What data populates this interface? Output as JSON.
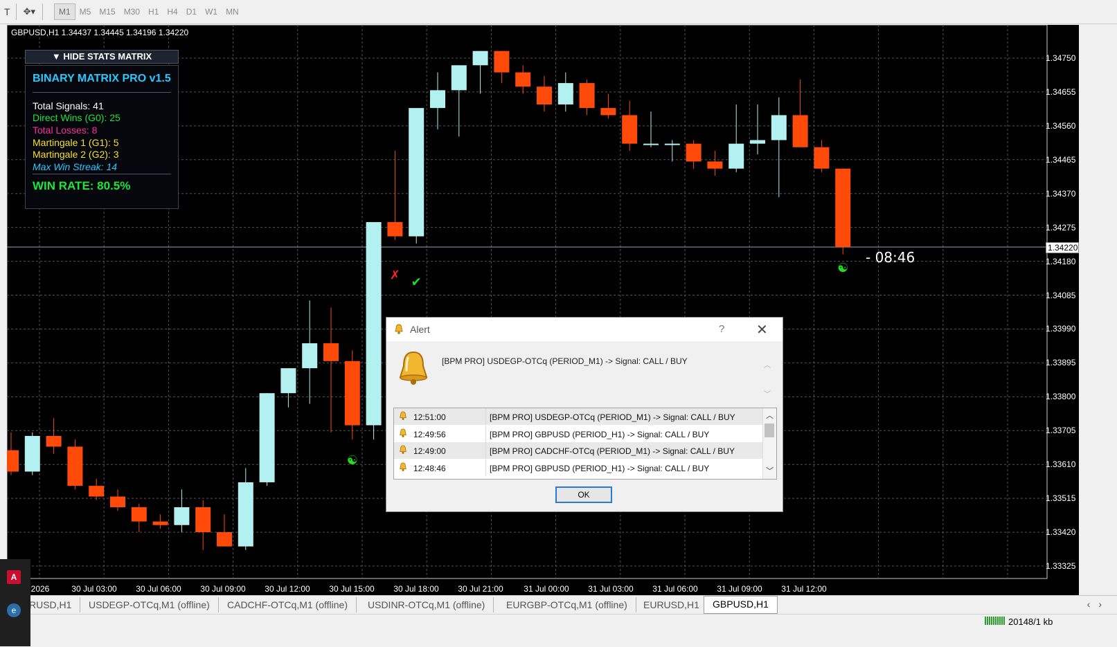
{
  "toolbar": {
    "timeframes": [
      "M1",
      "M5",
      "M15",
      "M30",
      "H1",
      "H4",
      "D1",
      "W1",
      "MN"
    ],
    "active_timeframe": "M1"
  },
  "chart": {
    "symbol_info": "GBPUSD,H1  1.34437 1.34445 1.34196 1.34220",
    "current_price": "1.34220",
    "countdown": "- 08:46",
    "price_axis": [
      "1.34750",
      "1.34655",
      "1.34560",
      "1.34465",
      "1.34370",
      "1.34275",
      "1.34180",
      "1.34085",
      "1.33990",
      "1.33895",
      "1.33800",
      "1.33705",
      "1.33610",
      "1.33515",
      "1.33420",
      "1.33325"
    ],
    "time_axis": [
      "2026",
      "30 Jul 03:00",
      "30 Jul 06:00",
      "30 Jul 09:00",
      "30 Jul 12:00",
      "30 Jul 15:00",
      "30 Jul 18:00",
      "30 Jul 21:00",
      "31 Jul 00:00",
      "31 Jul 03:00",
      "31 Jul 06:00",
      "31 Jul 09:00",
      "31 Jul 12:00"
    ],
    "colors": {
      "bull": "#b3f0f0",
      "bear": "#ff4a0a",
      "grid": "#555555"
    },
    "candles": [
      {
        "o": 1.3365,
        "h": 1.337,
        "l": 1.3358,
        "c": 1.3359
      },
      {
        "o": 1.3359,
        "h": 1.337,
        "l": 1.3358,
        "c": 1.3369
      },
      {
        "o": 1.3369,
        "h": 1.3374,
        "l": 1.3364,
        "c": 1.3366
      },
      {
        "o": 1.3366,
        "h": 1.3368,
        "l": 1.3354,
        "c": 1.3355
      },
      {
        "o": 1.3355,
        "h": 1.3357,
        "l": 1.3351,
        "c": 1.3352
      },
      {
        "o": 1.3352,
        "h": 1.3354,
        "l": 1.3348,
        "c": 1.3349
      },
      {
        "o": 1.3349,
        "h": 1.335,
        "l": 1.3342,
        "c": 1.3345
      },
      {
        "o": 1.3345,
        "h": 1.3347,
        "l": 1.3343,
        "c": 1.3344
      },
      {
        "o": 1.3344,
        "h": 1.3354,
        "l": 1.3342,
        "c": 1.3349
      },
      {
        "o": 1.3349,
        "h": 1.3351,
        "l": 1.3337,
        "c": 1.3342
      },
      {
        "o": 1.3342,
        "h": 1.3347,
        "l": 1.3338,
        "c": 1.3338
      },
      {
        "o": 1.3338,
        "h": 1.336,
        "l": 1.3337,
        "c": 1.3356
      },
      {
        "o": 1.3356,
        "h": 1.3381,
        "l": 1.3355,
        "c": 1.3381
      },
      {
        "o": 1.3381,
        "h": 1.3388,
        "l": 1.3377,
        "c": 1.3388
      },
      {
        "o": 1.3388,
        "h": 1.3407,
        "l": 1.3378,
        "c": 1.3395
      },
      {
        "o": 1.3395,
        "h": 1.3405,
        "l": 1.337,
        "c": 1.339
      },
      {
        "o": 1.339,
        "h": 1.3393,
        "l": 1.3368,
        "c": 1.3372
      },
      {
        "o": 1.3372,
        "h": 1.3429,
        "l": 1.3368,
        "c": 1.3429
      },
      {
        "o": 1.3429,
        "h": 1.3449,
        "l": 1.3424,
        "c": 1.3425
      },
      {
        "o": 1.3425,
        "h": 1.3461,
        "l": 1.3423,
        "c": 1.3461
      },
      {
        "o": 1.3461,
        "h": 1.3471,
        "l": 1.3455,
        "c": 1.3466
      },
      {
        "o": 1.3466,
        "h": 1.3473,
        "l": 1.3453,
        "c": 1.3473
      },
      {
        "o": 1.3473,
        "h": 1.3477,
        "l": 1.3465,
        "c": 1.3477
      },
      {
        "o": 1.3477,
        "h": 1.3477,
        "l": 1.3468,
        "c": 1.3471
      },
      {
        "o": 1.3471,
        "h": 1.3473,
        "l": 1.3465,
        "c": 1.3467
      },
      {
        "o": 1.3467,
        "h": 1.347,
        "l": 1.346,
        "c": 1.3462
      },
      {
        "o": 1.3462,
        "h": 1.3471,
        "l": 1.346,
        "c": 1.3468
      },
      {
        "o": 1.3468,
        "h": 1.3469,
        "l": 1.3459,
        "c": 1.3461
      },
      {
        "o": 1.3461,
        "h": 1.3465,
        "l": 1.3458,
        "c": 1.3459
      },
      {
        "o": 1.3459,
        "h": 1.3463,
        "l": 1.3449,
        "c": 1.3451
      },
      {
        "o": 1.3451,
        "h": 1.346,
        "l": 1.345,
        "c": 1.3451
      },
      {
        "o": 1.3451,
        "h": 1.3452,
        "l": 1.3446,
        "c": 1.3451
      },
      {
        "o": 1.3451,
        "h": 1.3452,
        "l": 1.3444,
        "c": 1.3446
      },
      {
        "o": 1.3446,
        "h": 1.3449,
        "l": 1.3442,
        "c": 1.3444
      },
      {
        "o": 1.3444,
        "h": 1.3462,
        "l": 1.3443,
        "c": 1.3451
      },
      {
        "o": 1.3451,
        "h": 1.3462,
        "l": 1.3448,
        "c": 1.3452
      },
      {
        "o": 1.3452,
        "h": 1.3464,
        "l": 1.3436,
        "c": 1.3459
      },
      {
        "o": 1.3459,
        "h": 1.3469,
        "l": 1.3452,
        "c": 1.345
      },
      {
        "o": 1.345,
        "h": 1.3452,
        "l": 1.3443,
        "c": 1.3444
      },
      {
        "o": 1.3444,
        "h": 1.3444,
        "l": 1.342,
        "c": 1.3422
      }
    ],
    "markers": [
      {
        "type": "loss",
        "label": "✗",
        "color": "#ff2020",
        "index": 18,
        "price": 1.3413
      },
      {
        "type": "win",
        "label": "✔",
        "color": "#20e020",
        "index": 19,
        "price": 1.3411
      },
      {
        "type": "signal",
        "label": "☯",
        "color": "#20e020",
        "index": 16,
        "price": 1.3361
      },
      {
        "type": "signal",
        "label": "☯",
        "color": "#20e020",
        "index": 39,
        "price": 1.3415
      }
    ]
  },
  "stats": {
    "toggle_label": "▼ HIDE STATS MATRIX",
    "title": "BINARY MATRIX PRO v1.5",
    "lines": [
      {
        "text": "Total Signals: 41",
        "color": "#ffffff"
      },
      {
        "text": "Direct Wins (G0): 25",
        "color": "#1ce63a"
      },
      {
        "text": "Total Losses: 8",
        "color": "#ff2da0"
      },
      {
        "text": "Martingale 1 (G1): 5",
        "color": "#f5e02a"
      },
      {
        "text": "Martingale 2 (G2): 3",
        "color": "#f5e02a"
      },
      {
        "text": "Max Win Streak: 14",
        "color": "#29c8ff"
      }
    ],
    "win_rate": "WIN RATE: 80.5%"
  },
  "alert": {
    "title": "Alert",
    "help": "?",
    "message": "[BPM PRO] USDEGP-OTCq (PERIOD_M1) -> Signal: CALL / BUY",
    "rows": [
      {
        "time": "12:51:00",
        "msg": "[BPM PRO] USDEGP-OTCq (PERIOD_M1) -> Signal: CALL / BUY"
      },
      {
        "time": "12:49:56",
        "msg": "[BPM PRO] GBPUSD (PERIOD_H1) -> Signal: CALL / BUY"
      },
      {
        "time": "12:49:00",
        "msg": "[BPM PRO] CADCHF-OTCq (PERIOD_M1) -> Signal: CALL / BUY"
      },
      {
        "time": "12:48:46",
        "msg": "[BPM PRO] GBPUSD (PERIOD_H1) -> Signal: CALL / BUY"
      }
    ],
    "ok_label": "OK"
  },
  "tabs": [
    "RUSD,H1",
    "USDEGP-OTCq,M1 (offline)",
    "CADCHF-OTCq,M1 (offline)",
    "USDINR-OTCq,M1 (offline)",
    "EURGBP-OTCq,M1 (offline)",
    "EURUSD,H1",
    "GBPUSD,H1"
  ],
  "active_tab": "GBPUSD,H1",
  "status": {
    "traffic": "20148/1 kb"
  }
}
